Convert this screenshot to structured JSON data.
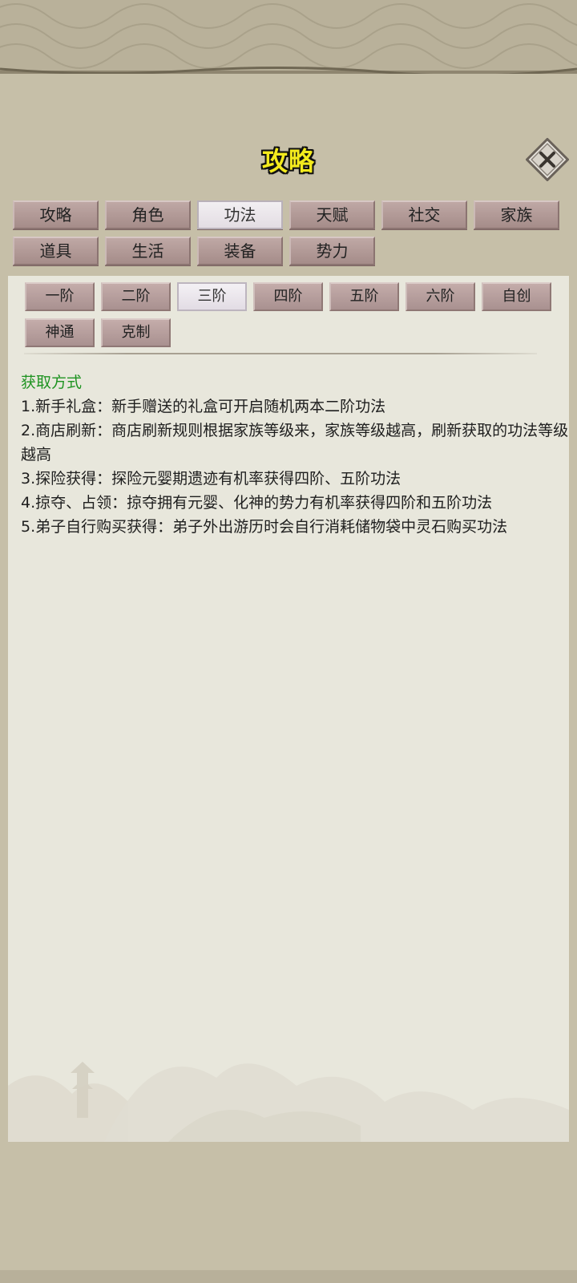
{
  "header": {
    "title": "攻略",
    "close_icon": "close-icon"
  },
  "tabs": [
    {
      "label": "攻略",
      "active": false
    },
    {
      "label": "角色",
      "active": false
    },
    {
      "label": "功法",
      "active": true
    },
    {
      "label": "天赋",
      "active": false
    },
    {
      "label": "社交",
      "active": false
    },
    {
      "label": "家族",
      "active": false
    },
    {
      "label": "道具",
      "active": false
    },
    {
      "label": "生活",
      "active": false
    },
    {
      "label": "装备",
      "active": false
    },
    {
      "label": "势力",
      "active": false
    }
  ],
  "subtabs": [
    {
      "label": "一阶",
      "active": false
    },
    {
      "label": "二阶",
      "active": false
    },
    {
      "label": "三阶",
      "active": true
    },
    {
      "label": "四阶",
      "active": false
    },
    {
      "label": "五阶",
      "active": false
    },
    {
      "label": "六阶",
      "active": false
    },
    {
      "label": "自创",
      "active": false
    },
    {
      "label": "神通",
      "active": false
    },
    {
      "label": "克制",
      "active": false
    }
  ],
  "content": {
    "heading": "获取方式",
    "lines": [
      "1.新手礼盒：新手赠送的礼盒可开启随机两本二阶功法",
      "2.商店刷新：商店刷新规则根据家族等级来，家族等级越高，刷新获取的功法等级越高",
      "3.探险获得：探险元婴期遗迹有机率获得四阶、五阶功法",
      "4.掠夺、占领：掠夺拥有元婴、化神的势力有机率获得四阶和五阶功法",
      "5.弟子自行购买获得：弟子外出游历时会自行消耗储物袋中灵石购买功法"
    ]
  },
  "colors": {
    "title": "#f3ea1d",
    "heading": "#1e9321",
    "tab": "#b39b98",
    "tab_active": "#eeeaee",
    "content_bg": "#e8e7dc"
  }
}
